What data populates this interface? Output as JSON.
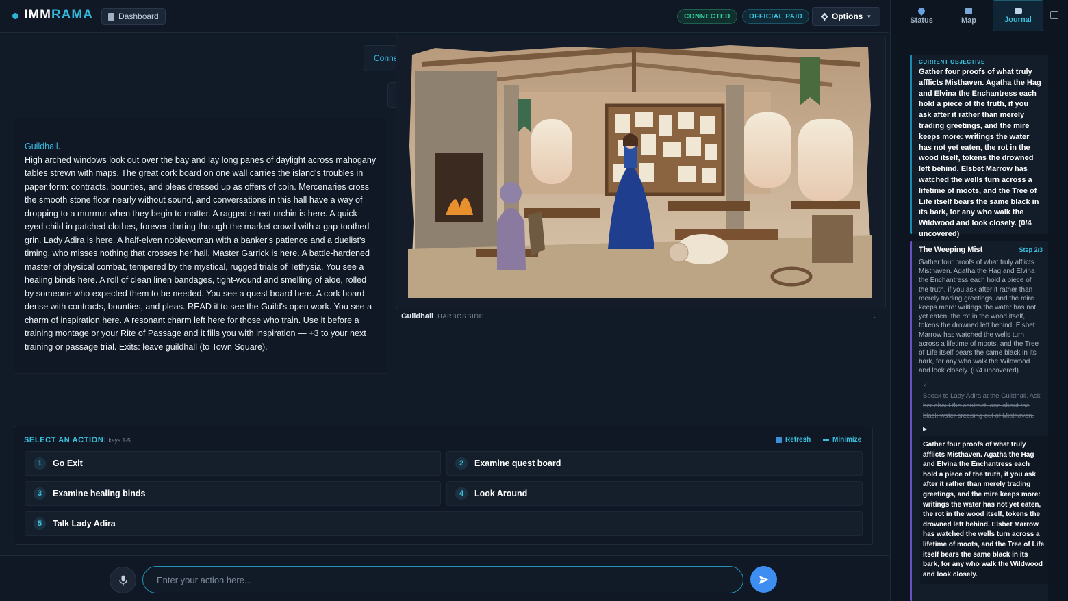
{
  "header": {
    "logo_part1": "IMM",
    "logo_part2": "RAMA",
    "dashboard_label": "Dashboard",
    "connected_label": "CONNECTED",
    "paid_label": "OFFICIAL PAID",
    "options_label": "Options"
  },
  "right_tabs": [
    {
      "label": "Status",
      "icon": "pin-icon"
    },
    {
      "label": "Map",
      "icon": "map-icon"
    },
    {
      "label": "Journal",
      "icon": "book-icon",
      "active": true
    }
  ],
  "objective": {
    "heading": "CURRENT OBJECTIVE",
    "text": "Gather four proofs of what truly afflicts Misthaven. Agatha the Hag and Elvina the Enchantress each hold a piece of the truth, if you ask after it rather than merely trading greetings, and the mire keeps more: writings the water has not yet eaten, the rot in the wood itself, tokens the drowned left behind. Elsbet Marrow has watched the wells turn across a lifetime of moots, and the Tree of Life itself bears the same black in its bark, for any who walk the Wildwood and look closely. (0/4 uncovered)"
  },
  "quest": {
    "title": "The Weeping Mist",
    "step": "Step 2/3",
    "description": "Gather four proofs of what truly afflicts Misthaven. Agatha the Hag and Elvina the Enchantress each hold a piece of the truth, if you ask after it rather than merely trading greetings, and the mire keeps more: writings the water has not yet eaten, the rot in the wood itself, tokens the drowned left behind. Elsbet Marrow has watched the wells turn across a lifetime of moots, and the Tree of Life itself bears the same black in its bark, for any who walk the Wildwood and look closely. (0/4 uncovered)",
    "check_mark": "✓",
    "completed_step": "Speak to Lady Adira at the Guildhall. Ask her about the contract, and about the black water creeping out of Misthaven.",
    "current_marker": "▶",
    "current_step": "Gather four proofs of what truly afflicts Misthaven. Agatha the Hag and Elvina the Enchantress each hold a piece of the truth, if you ask after it rather than merely trading greetings, and the mire keeps more: writings the water has not yet eaten, the rot in the wood itself, tokens the drowned left behind. Elsbet Marrow has watched the wells turn across a lifetime of moots, and the Tree of Life itself bears the same black in its bark, for any who walk the Wildwood and look closely."
  },
  "narrative": {
    "ghost_label": "Conne",
    "location": "Guildhall",
    "location_period": ".",
    "text": "High arched windows look out over the bay and lay long panes of daylight across mahogany tables strewn with maps. The great cork board on one wall carries the island's troubles in paper form: contracts, bounties, and pleas dressed up as offers of coin. Mercenaries cross the smooth stone floor nearly without sound, and conversations in this hall have a way of dropping to a murmur when they begin to matter. A ragged street urchin is here. A quick-eyed child in patched clothes, forever darting through the market crowd with a gap-toothed grin. Lady Adira is here. A half-elven noblewoman with a banker's patience and a duelist's timing, who misses nothing that crosses her hall. Master Garrick is here. A battle-hardened master of physical combat, tempered by the mystical, rugged trials of Tethysia. You see a healing binds here. A roll of clean linen bandages, tight-wound and smelling of aloe, rolled by someone who expected them to be needed. You see a quest board here. A cork board dense with contracts, bounties, and pleas. READ it to see the Guild's open work. You see a charm of inspiration here. A resonant charm left here for those who train. Use it before a training montage or your Rite of Passage and it fills you with inspiration — +3 to your next training or passage trial. Exits: leave guildhall (to Town Square)."
  },
  "scene": {
    "caption_name": "Guildhall",
    "caption_sub": "HARBORSIDE",
    "caret": "⌄"
  },
  "actions": {
    "title": "SELECT AN ACTION:",
    "keys_hint": "keys 1-5",
    "refresh_label": "Refresh",
    "minimize_label": "Minimize",
    "items": [
      {
        "num": "1",
        "label": "Go Exit"
      },
      {
        "num": "2",
        "label": "Examine quest board"
      },
      {
        "num": "3",
        "label": "Examine healing binds"
      },
      {
        "num": "4",
        "label": "Look Around"
      },
      {
        "num": "5",
        "label": "Talk Lady Adira"
      }
    ]
  },
  "input": {
    "placeholder": "Enter your action here...",
    "value": ""
  },
  "colors": {
    "accent": "#3bc1de",
    "connected": "#35d0a4",
    "send": "#3d8ef0",
    "quest_border": "#6a4fc6"
  }
}
